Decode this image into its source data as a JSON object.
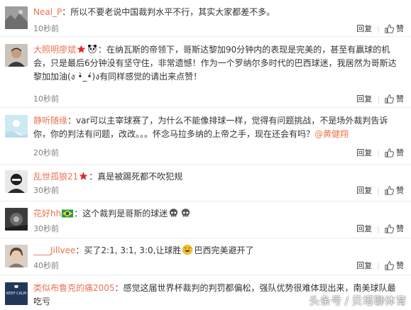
{
  "comments": [
    {
      "user": "Neal_P",
      "text": "：所以不要老说中国裁判水平不行，其实大家都差不多。",
      "time": "10秒前",
      "reply": "回复",
      "like": "赞"
    },
    {
      "user": "大照明廖斌",
      "text1": "：在纳瓦斯的帝领下，哥斯达黎加90分钟内的表现是完美的，甚至有赢球的机会，只是最后6分钟没有坚守住，非常遗憾！作为一个罗纳尔多时代的巴西球迷，我居然为哥斯达黎加加油",
      "emoji_text": "(ง •̀_•́)ง",
      "text2": "有同样感觉的请出来点赞！",
      "time": "10秒前",
      "reply": "回复",
      "like": "赞"
    },
    {
      "user": "静听随缘",
      "text": "：var可以主宰球赛了，为什么不能像排球一样，觉得有问题挑战，不是场外裁判告诉你，你的判法有问题，改改。。。怀念马拉多纳的上帝之手，现在还会有吗？",
      "mention": "@黄健翔",
      "time": "20秒前",
      "reply": "回复",
      "like": "赞"
    },
    {
      "user": "乱世孤狼21",
      "text": "：真是被踢死都不吹犯规",
      "time": "30秒前",
      "reply": "回复",
      "like": "赞"
    },
    {
      "user": "花好hh",
      "text": "：这个裁判是哥斯的球迷",
      "time": "30秒前",
      "reply": "回复",
      "like": "赞"
    },
    {
      "user": "____Jillvee",
      "text1": "：买了2:1, 3:1, 3:0,让球胜",
      "text2": "巴西完美避开了",
      "time": "40秒前",
      "reply": "回复",
      "like": "赞"
    },
    {
      "user": "类似布鲁克的痛2005",
      "text": "：感觉这届世界杯裁判的判罚都偏松，强队优势很难体现出来，南美球队最吃亏",
      "avatar_text": "KEEP CALM"
    }
  ],
  "watermark": {
    "left": "头条号",
    "right": "贝塔聊体育"
  },
  "colors": {
    "username": "#eb7350",
    "time": "#808080",
    "divider": "#ececec"
  }
}
